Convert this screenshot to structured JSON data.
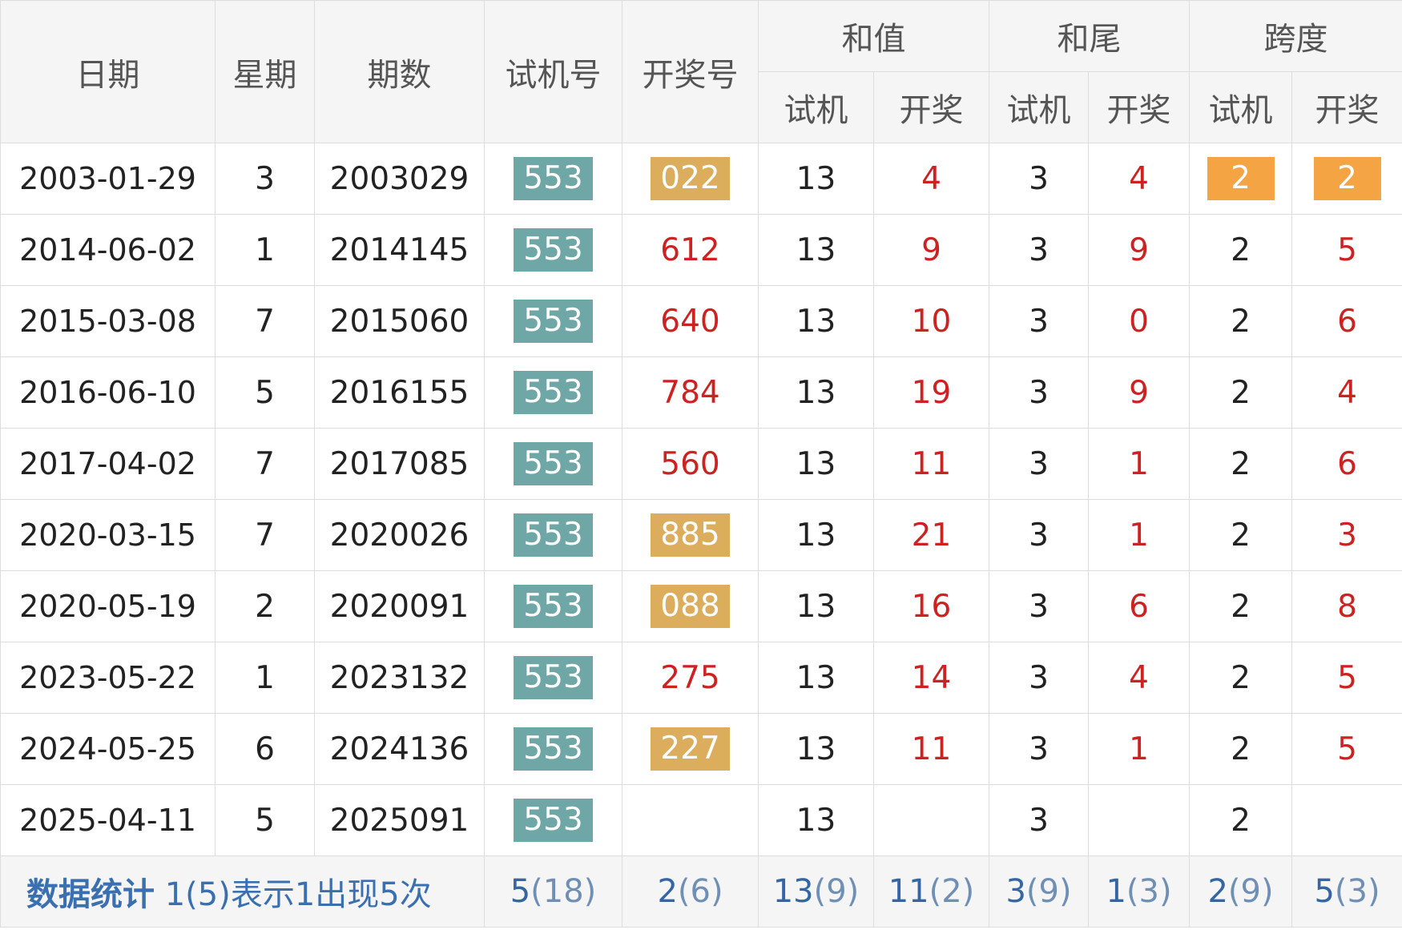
{
  "headers": {
    "date": "日期",
    "weekday": "星期",
    "issue": "期数",
    "trial_no": "试机号",
    "award_no": "开奖号",
    "sum": "和值",
    "tail": "和尾",
    "span": "跨度",
    "sub_trial": "试机",
    "sub_award": "开奖"
  },
  "rows": [
    {
      "date": "2003-01-29",
      "weekday": "3",
      "issue": "2003029",
      "trial": "553",
      "award": "022",
      "award_hl": true,
      "sum_trial": "13",
      "sum_award": "4",
      "tail_trial": "3",
      "tail_award": "4",
      "span_trial": "2",
      "span_award": "2",
      "span_hl": true
    },
    {
      "date": "2014-06-02",
      "weekday": "1",
      "issue": "2014145",
      "trial": "553",
      "award": "612",
      "award_hl": false,
      "sum_trial": "13",
      "sum_award": "9",
      "tail_trial": "3",
      "tail_award": "9",
      "span_trial": "2",
      "span_award": "5",
      "span_hl": false
    },
    {
      "date": "2015-03-08",
      "weekday": "7",
      "issue": "2015060",
      "trial": "553",
      "award": "640",
      "award_hl": false,
      "sum_trial": "13",
      "sum_award": "10",
      "tail_trial": "3",
      "tail_award": "0",
      "span_trial": "2",
      "span_award": "6",
      "span_hl": false
    },
    {
      "date": "2016-06-10",
      "weekday": "5",
      "issue": "2016155",
      "trial": "553",
      "award": "784",
      "award_hl": false,
      "sum_trial": "13",
      "sum_award": "19",
      "tail_trial": "3",
      "tail_award": "9",
      "span_trial": "2",
      "span_award": "4",
      "span_hl": false
    },
    {
      "date": "2017-04-02",
      "weekday": "7",
      "issue": "2017085",
      "trial": "553",
      "award": "560",
      "award_hl": false,
      "sum_trial": "13",
      "sum_award": "11",
      "tail_trial": "3",
      "tail_award": "1",
      "span_trial": "2",
      "span_award": "6",
      "span_hl": false
    },
    {
      "date": "2020-03-15",
      "weekday": "7",
      "issue": "2020026",
      "trial": "553",
      "award": "885",
      "award_hl": true,
      "sum_trial": "13",
      "sum_award": "21",
      "tail_trial": "3",
      "tail_award": "1",
      "span_trial": "2",
      "span_award": "3",
      "span_hl": false
    },
    {
      "date": "2020-05-19",
      "weekday": "2",
      "issue": "2020091",
      "trial": "553",
      "award": "088",
      "award_hl": true,
      "sum_trial": "13",
      "sum_award": "16",
      "tail_trial": "3",
      "tail_award": "6",
      "span_trial": "2",
      "span_award": "8",
      "span_hl": false
    },
    {
      "date": "2023-05-22",
      "weekday": "1",
      "issue": "2023132",
      "trial": "553",
      "award": "275",
      "award_hl": false,
      "sum_trial": "13",
      "sum_award": "14",
      "tail_trial": "3",
      "tail_award": "4",
      "span_trial": "2",
      "span_award": "5",
      "span_hl": false
    },
    {
      "date": "2024-05-25",
      "weekday": "6",
      "issue": "2024136",
      "trial": "553",
      "award": "227",
      "award_hl": true,
      "sum_trial": "13",
      "sum_award": "11",
      "tail_trial": "3",
      "tail_award": "1",
      "span_trial": "2",
      "span_award": "5",
      "span_hl": false
    },
    {
      "date": "2025-04-11",
      "weekday": "5",
      "issue": "2025091",
      "trial": "553",
      "award": "",
      "award_hl": false,
      "sum_trial": "13",
      "sum_award": "",
      "tail_trial": "3",
      "tail_award": "",
      "span_trial": "2",
      "span_award": "",
      "span_hl": false
    }
  ],
  "footer": {
    "label_strong": "数据统计",
    "label_desc": "1(5)表示1出现5次",
    "trial_no": {
      "num": "5",
      "cnt": "(18)"
    },
    "award_no": {
      "num": "2",
      "cnt": "(6)"
    },
    "sum_trial": {
      "num": "13",
      "cnt": "(9)"
    },
    "sum_award": {
      "num": "11",
      "cnt": "(2)"
    },
    "tail_trial": {
      "num": "3",
      "cnt": "(9)"
    },
    "tail_award": {
      "num": "1",
      "cnt": "(3)"
    },
    "span_trial": {
      "num": "2",
      "cnt": "(9)"
    },
    "span_award": {
      "num": "5",
      "cnt": "(3)"
    }
  },
  "colors": {
    "trial_chip": "#6ea7a5",
    "award_chip": "#dcad5d",
    "span_chip": "#f5a443",
    "red_text": "#cc2222",
    "footer_blue": "#3465a4"
  }
}
